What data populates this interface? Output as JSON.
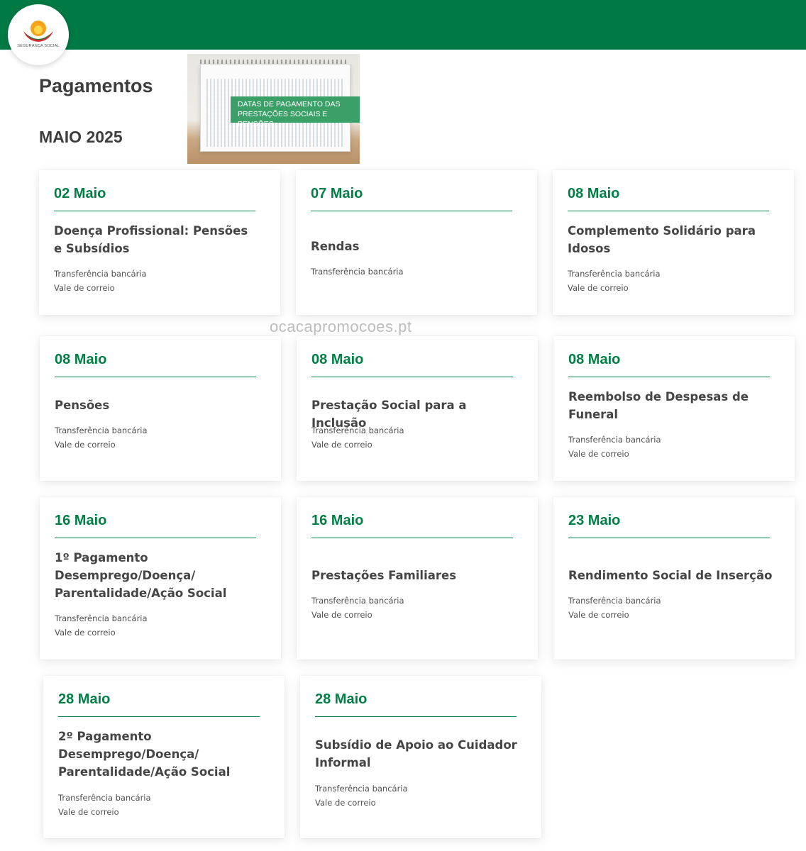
{
  "header": {
    "logo_text": "SEGURANÇA SOCIAL",
    "brand_color": "#007a44",
    "accent_color": "#008046"
  },
  "page": {
    "title": "Pagamentos",
    "month": "MAIO 2025"
  },
  "banner": {
    "text_line1": "DATAS DE PAGAMENTO DAS",
    "text_line2": "PRESTAÇÕES SOCIAIS E PENSÕES"
  },
  "watermark": "ocacapromocoes.pt",
  "cards": [
    {
      "date": "02 Maio",
      "title": "Doença Profissional: Pensões e Subsídios",
      "methods": [
        "Transferência bancária",
        "Vale de correio"
      ]
    },
    {
      "date": "07 Maio",
      "title": "Rendas",
      "methods": [
        "Transferência bancária"
      ]
    },
    {
      "date": "08 Maio",
      "title": "Complemento Solidário para Idosos",
      "methods": [
        "Transferência bancária",
        "Vale de correio"
      ]
    },
    {
      "date": "08 Maio",
      "title": "Pensões",
      "methods": [
        "Transferência bancária",
        "Vale de correio"
      ]
    },
    {
      "date": "08 Maio",
      "title": "Prestação Social para a Inclusão",
      "methods": [
        "Transferência bancária",
        "Vale de correio"
      ]
    },
    {
      "date": "08 Maio",
      "title": "Reembolso de Despesas de Funeral",
      "methods": [
        "Transferência bancária",
        "Vale de correio"
      ]
    },
    {
      "date": "16 Maio",
      "title": "1º Pagamento Desemprego/Doença/ Parentalidade/Ação Social",
      "methods": [
        "Transferência bancária",
        "Vale de correio"
      ]
    },
    {
      "date": "16 Maio",
      "title": "Prestações Familiares",
      "methods": [
        "Transferência bancária",
        "Vale de correio"
      ]
    },
    {
      "date": "23 Maio",
      "title": "Rendimento Social de Inserção",
      "methods": [
        "Transferência bancária",
        "Vale de correio"
      ]
    },
    {
      "date": "28 Maio",
      "title": "2º Pagamento Desemprego/Doença/ Parentalidade/Ação Social",
      "methods": [
        "Transferência bancária",
        "Vale de correio"
      ]
    },
    {
      "date": "28 Maio",
      "title": "Subsídio de Apoio ao Cuidador Informal",
      "methods": [
        "Transferência bancária",
        "Vale de correio"
      ]
    }
  ]
}
